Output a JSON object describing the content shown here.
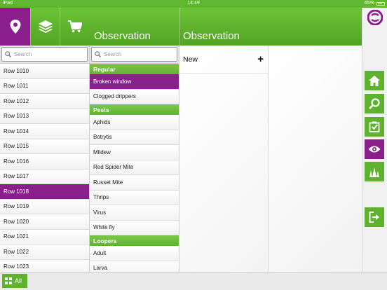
{
  "status": {
    "device": "iPad",
    "time": "14:49",
    "battery": "65%",
    "battery_level": 0.65
  },
  "header": {
    "title_left": "Observation",
    "title_right": "Observation"
  },
  "column1": {
    "search_placeholder": "Search",
    "rows": [
      "Row 1010",
      "Row 1011",
      "Row 1012",
      "Row 1013",
      "Row 1014",
      "Row 1015",
      "Row 1016",
      "Row 1017",
      "Row 1018",
      "Row 1019",
      "Row 1020",
      "Row 1021",
      "Row 1022",
      "Row 1023"
    ],
    "selected": "Row 1018"
  },
  "column2": {
    "search_placeholder": "Search",
    "sections": [
      {
        "title": "Regular",
        "items": [
          "Broken window",
          "Clogged drippers"
        ]
      },
      {
        "title": "Pests",
        "items": [
          "Aphids",
          "Botrytis",
          "Mildew",
          "Red Spider Mite",
          "Russet Mite",
          "Thrips",
          "Virus",
          "White fly"
        ]
      },
      {
        "title": "Loopers",
        "items": [
          "Adult",
          "Larva"
        ]
      }
    ],
    "selected": "Broken window"
  },
  "column3": {
    "new_label": "New",
    "add_symbol": "+"
  },
  "sidebar": {
    "buttons": [
      {
        "name": "home-icon",
        "active": false
      },
      {
        "name": "search-icon",
        "active": false
      },
      {
        "name": "task-icon",
        "active": false
      },
      {
        "name": "eye-icon",
        "active": true
      },
      {
        "name": "plant-icon",
        "active": false
      },
      {
        "name": "logout-icon",
        "active": false
      }
    ]
  },
  "footer": {
    "all_label": "All"
  },
  "colors": {
    "green": "#5fb22f",
    "purple": "#8a1f8c"
  }
}
